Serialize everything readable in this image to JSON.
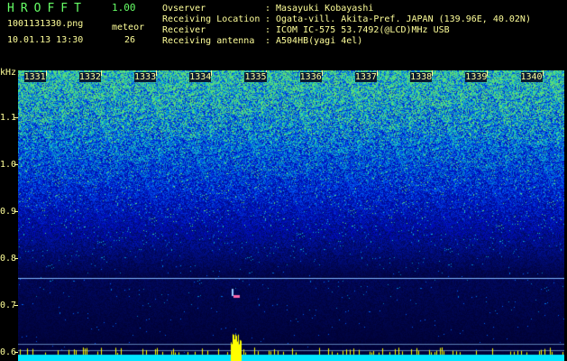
{
  "header": {
    "brand": "HROFFT",
    "version": "1.00",
    "filename": "1001131330.png",
    "datetime": "10.01.13 13:30",
    "meteor_label": "meteor",
    "meteor_count": "26"
  },
  "info": [
    {
      "key": "Ovserver",
      "value": "Masayuki Kobayashi"
    },
    {
      "key": "Receiving Location",
      "value": "Ogata-vill. Akita-Pref. JAPAN (139.96E, 40.02N)"
    },
    {
      "key": "Receiver",
      "value": "ICOM IC-575 53.7492(@LCD)MHz USB"
    },
    {
      "key": "Receiving antenna",
      "value": "A504HB(yagi 4el)"
    }
  ],
  "axis": {
    "y_unit": "kHz",
    "y_ticks": [
      "1.1",
      "1.0",
      "0.9",
      "0.8",
      "0.7",
      "0.6"
    ],
    "y_values": [
      1.1,
      1.0,
      0.9,
      0.8,
      0.7,
      0.6
    ],
    "y_range": [
      0.58,
      1.2
    ],
    "x_ticks": [
      "1331",
      "1332",
      "1333",
      "1334",
      "1335",
      "1336",
      "1337",
      "1338",
      "1339",
      "1340"
    ],
    "x_values": [
      1331,
      1332,
      1333,
      1334,
      1335,
      1336,
      1337,
      1338,
      1339,
      1340
    ],
    "x_range": [
      1330.5,
      1340.4
    ]
  },
  "colors": {
    "text": "#ffff99",
    "brand": "#66ff66",
    "line": "#7fb7ff",
    "baseline": "#00e5ff",
    "noise_peak": "#ffff00"
  }
}
